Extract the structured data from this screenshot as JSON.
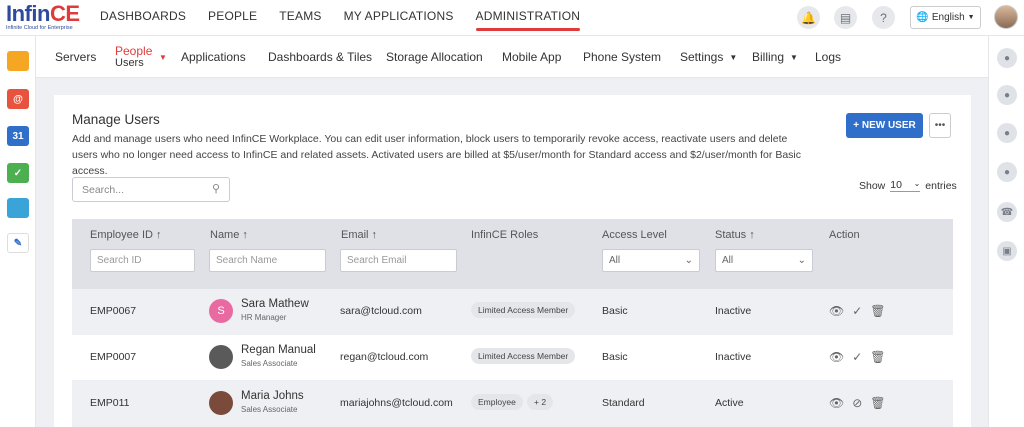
{
  "brand": {
    "name_a": "Infin",
    "name_b": "CE",
    "tagline": "Infinite Cloud for Enterprise"
  },
  "main_nav": [
    {
      "label": "DASHBOARDS"
    },
    {
      "label": "PEOPLE"
    },
    {
      "label": "TEAMS"
    },
    {
      "label": "MY APPLICATIONS"
    },
    {
      "label": "ADMINISTRATION",
      "active": true
    }
  ],
  "top_right": {
    "language": "English",
    "icons": [
      "bell-icon",
      "news-icon",
      "help-icon",
      "globe-icon"
    ]
  },
  "sub_nav": {
    "servers": "Servers",
    "people": "People",
    "people_sub": "Users",
    "applications": "Applications",
    "dashboards": "Dashboards & Tiles",
    "storage": "Storage Allocation",
    "mobile": "Mobile App",
    "phone": "Phone System",
    "settings": "Settings",
    "billing": "Billing",
    "logs": "Logs"
  },
  "left_apps": [
    {
      "icon": "folder-icon",
      "color": "#f5a623"
    },
    {
      "icon": "mail-icon",
      "color": "#e8533f"
    },
    {
      "icon": "calendar-icon",
      "color": "#2f6ec9",
      "text": "31"
    },
    {
      "icon": "tasks-icon",
      "color": "#4caf50"
    },
    {
      "icon": "photos-icon",
      "color": "#3aa3d8"
    },
    {
      "icon": "spaces-icon",
      "color": "#ffffff"
    }
  ],
  "right_icons": [
    "chat-icon",
    "user-icon",
    "user-group-icon",
    "team-icon",
    "phone-icon",
    "task-icon"
  ],
  "card": {
    "title": "Manage Users",
    "description": "Add and manage users who need InfinCE Workplace. You can edit user information, block users to temporarily revoke access, reactivate users and delete users who no longer need access to InfinCE and related assets. Activated users are billed at  $5/user/month for Standard access and $2/user/month for Basic access.",
    "new_user": "+ NEW USER",
    "more": "•••",
    "search_placeholder": "Search...",
    "show_label": "Show",
    "show_value": "10",
    "entries_label": "entries"
  },
  "columns": {
    "employee_id": "Employee ID ↑",
    "name": "Name ↑",
    "email": "Email ↑",
    "roles": "InfinCE Roles",
    "access": "Access Level",
    "status": "Status ↑",
    "action": "Action"
  },
  "filters": {
    "id_placeholder": "Search ID",
    "name_placeholder": "Search Name",
    "email_placeholder": "Search Email",
    "access_value": "All",
    "status_value": "All"
  },
  "rows": [
    {
      "id": "EMP0067",
      "name": "Sara Mathew",
      "role": "HR Manager",
      "email": "sara@tcloud.com",
      "badge": "Limited Access Member",
      "badge_extra": "",
      "access": "Basic",
      "status": "Inactive",
      "avatar_letter": "S",
      "avatar_color": "#e86aa1"
    },
    {
      "id": "EMP0007",
      "name": "Regan Manual",
      "role": "Sales Associate",
      "email": "regan@tcloud.com",
      "badge": "Limited Access Member",
      "badge_extra": "",
      "access": "Basic",
      "status": "Inactive",
      "avatar_letter": "",
      "avatar_color": "#5a5a5a"
    },
    {
      "id": "EMP011",
      "name": "Maria Johns",
      "role": "Sales Associate",
      "email": "mariajohns@tcloud.com",
      "badge": "Employee",
      "badge_extra": "+ 2",
      "access": "Standard",
      "status": "Active",
      "avatar_letter": "",
      "avatar_color": "#7a4a3a"
    }
  ]
}
